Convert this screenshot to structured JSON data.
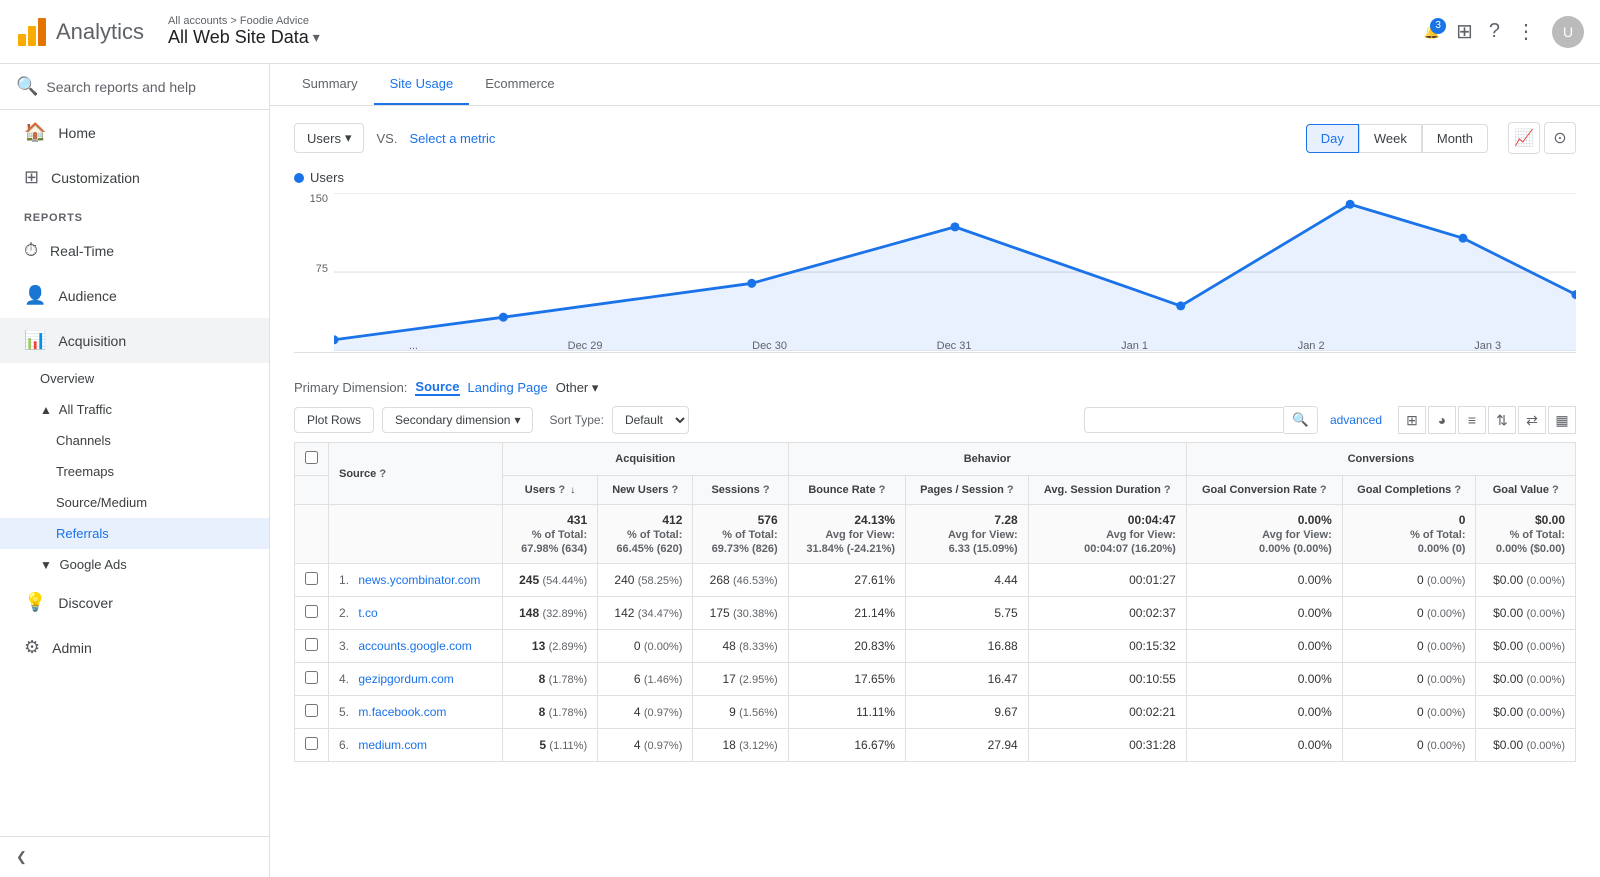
{
  "topbar": {
    "logo_text": "Analytics",
    "account_path": "All accounts > Foodie Advice",
    "property": "All Web Site Data",
    "notif_count": "3",
    "avatar_text": "U"
  },
  "tabs": [
    "Summary",
    "Site Usage",
    "Ecommerce"
  ],
  "chart": {
    "metric_label": "Users",
    "vs_text": "VS.",
    "select_metric": "Select a metric",
    "time_buttons": [
      "Day",
      "Week",
      "Month"
    ],
    "active_time": "Day",
    "y_labels": [
      "150",
      "75",
      ""
    ],
    "x_labels": [
      "...",
      "Dec 29",
      "Dec 30",
      "Dec 31",
      "Jan 1",
      "Jan 2",
      "Jan 3"
    ],
    "legend": "Users"
  },
  "primary_dimension": {
    "label": "Primary Dimension:",
    "options": [
      "Source",
      "Landing Page",
      "Other"
    ]
  },
  "table_controls": {
    "plot_rows": "Plot Rows",
    "secondary_dimension": "Secondary dimension",
    "sort_type_label": "Sort Type:",
    "sort_default": "Default",
    "advanced": "advanced",
    "search_placeholder": ""
  },
  "table": {
    "headers": {
      "source": "Source",
      "acquisition": "Acquisition",
      "behavior": "Behavior",
      "conversions": "Conversions",
      "users": "Users",
      "new_users": "New Users",
      "sessions": "Sessions",
      "bounce_rate": "Bounce Rate",
      "pages_session": "Pages / Session",
      "avg_session": "Avg. Session Duration",
      "goal_conv_rate": "Goal Conversion Rate",
      "goal_completions": "Goal Completions",
      "goal_value": "Goal Value"
    },
    "totals": {
      "users": "431",
      "users_pct": "% of Total: 67.98% (634)",
      "new_users": "412",
      "new_users_pct": "% of Total: 66.45% (620)",
      "sessions": "576",
      "sessions_pct": "% of Total: 69.73% (826)",
      "bounce_rate": "24.13%",
      "bounce_rate_sub": "Avg for View: 31.84% (-24.21%)",
      "pages_session": "7.28",
      "pages_sub": "Avg for View: 6.33 (15.09%)",
      "avg_session": "00:04:47",
      "avg_sub": "Avg for View: 00:04:07 (16.20%)",
      "goal_conv": "0.00%",
      "goal_conv_sub": "Avg for View: 0.00% (0.00%)",
      "goal_comp": "0",
      "goal_comp_sub": "% of Total: 0.00% (0)",
      "goal_value": "$0.00",
      "goal_value_sub": "% of Total: 0.00% ($0.00)"
    },
    "rows": [
      {
        "num": "1",
        "source": "news.ycombinator.com",
        "users": "245",
        "users_pct": "(54.44%)",
        "new_users": "240",
        "new_users_pct": "(58.25%)",
        "sessions": "268",
        "sessions_pct": "(46.53%)",
        "bounce_rate": "27.61%",
        "pages_session": "4.44",
        "avg_session": "00:01:27",
        "goal_conv": "0.00%",
        "goal_comp": "0",
        "goal_comp_pct": "(0.00%)",
        "goal_value": "$0.00",
        "goal_value_pct": "(0.00%)"
      },
      {
        "num": "2",
        "source": "t.co",
        "users": "148",
        "users_pct": "(32.89%)",
        "new_users": "142",
        "new_users_pct": "(34.47%)",
        "sessions": "175",
        "sessions_pct": "(30.38%)",
        "bounce_rate": "21.14%",
        "pages_session": "5.75",
        "avg_session": "00:02:37",
        "goal_conv": "0.00%",
        "goal_comp": "0",
        "goal_comp_pct": "(0.00%)",
        "goal_value": "$0.00",
        "goal_value_pct": "(0.00%)"
      },
      {
        "num": "3",
        "source": "accounts.google.com",
        "users": "13",
        "users_pct": "(2.89%)",
        "new_users": "0",
        "new_users_pct": "(0.00%)",
        "sessions": "48",
        "sessions_pct": "(8.33%)",
        "bounce_rate": "20.83%",
        "pages_session": "16.88",
        "avg_session": "00:15:32",
        "goal_conv": "0.00%",
        "goal_comp": "0",
        "goal_comp_pct": "(0.00%)",
        "goal_value": "$0.00",
        "goal_value_pct": "(0.00%)"
      },
      {
        "num": "4",
        "source": "gezipgordum.com",
        "users": "8",
        "users_pct": "(1.78%)",
        "new_users": "6",
        "new_users_pct": "(1.46%)",
        "sessions": "17",
        "sessions_pct": "(2.95%)",
        "bounce_rate": "17.65%",
        "pages_session": "16.47",
        "avg_session": "00:10:55",
        "goal_conv": "0.00%",
        "goal_comp": "0",
        "goal_comp_pct": "(0.00%)",
        "goal_value": "$0.00",
        "goal_value_pct": "(0.00%)"
      },
      {
        "num": "5",
        "source": "m.facebook.com",
        "users": "8",
        "users_pct": "(1.78%)",
        "new_users": "4",
        "new_users_pct": "(0.97%)",
        "sessions": "9",
        "sessions_pct": "(1.56%)",
        "bounce_rate": "11.11%",
        "pages_session": "9.67",
        "avg_session": "00:02:21",
        "goal_conv": "0.00%",
        "goal_comp": "0",
        "goal_comp_pct": "(0.00%)",
        "goal_value": "$0.00",
        "goal_value_pct": "(0.00%)"
      },
      {
        "num": "6",
        "source": "medium.com",
        "users": "5",
        "users_pct": "(1.11%)",
        "new_users": "4",
        "new_users_pct": "(0.97%)",
        "sessions": "18",
        "sessions_pct": "(3.12%)",
        "bounce_rate": "16.67%",
        "pages_session": "27.94",
        "avg_session": "00:31:28",
        "goal_conv": "0.00%",
        "goal_comp": "0",
        "goal_comp_pct": "(0.00%)",
        "goal_value": "$0.00",
        "goal_value_pct": "(0.00%)"
      }
    ]
  },
  "sidebar": {
    "search_placeholder": "Search reports and help",
    "nav_items": [
      {
        "label": "Home",
        "icon": "🏠"
      },
      {
        "label": "Customization",
        "icon": "⊞"
      }
    ],
    "reports_label": "REPORTS",
    "report_items": [
      {
        "label": "Real-Time",
        "icon": "⏱"
      },
      {
        "label": "Audience",
        "icon": "👤"
      },
      {
        "label": "Acquisition",
        "icon": "📊",
        "active": true
      },
      {
        "label": "Overview",
        "sub": true
      },
      {
        "label": "All Traffic",
        "sub": true,
        "expanded": true
      },
      {
        "label": "Channels",
        "sub2": true
      },
      {
        "label": "Treemaps",
        "sub2": true
      },
      {
        "label": "Source/Medium",
        "sub2": true
      },
      {
        "label": "Referrals",
        "sub2": true,
        "active": true
      },
      {
        "label": "Google Ads",
        "sub": true
      },
      {
        "label": "Discover",
        "icon": "💡"
      },
      {
        "label": "Admin",
        "icon": "⚙"
      }
    ],
    "collapse_label": "Collapse"
  }
}
